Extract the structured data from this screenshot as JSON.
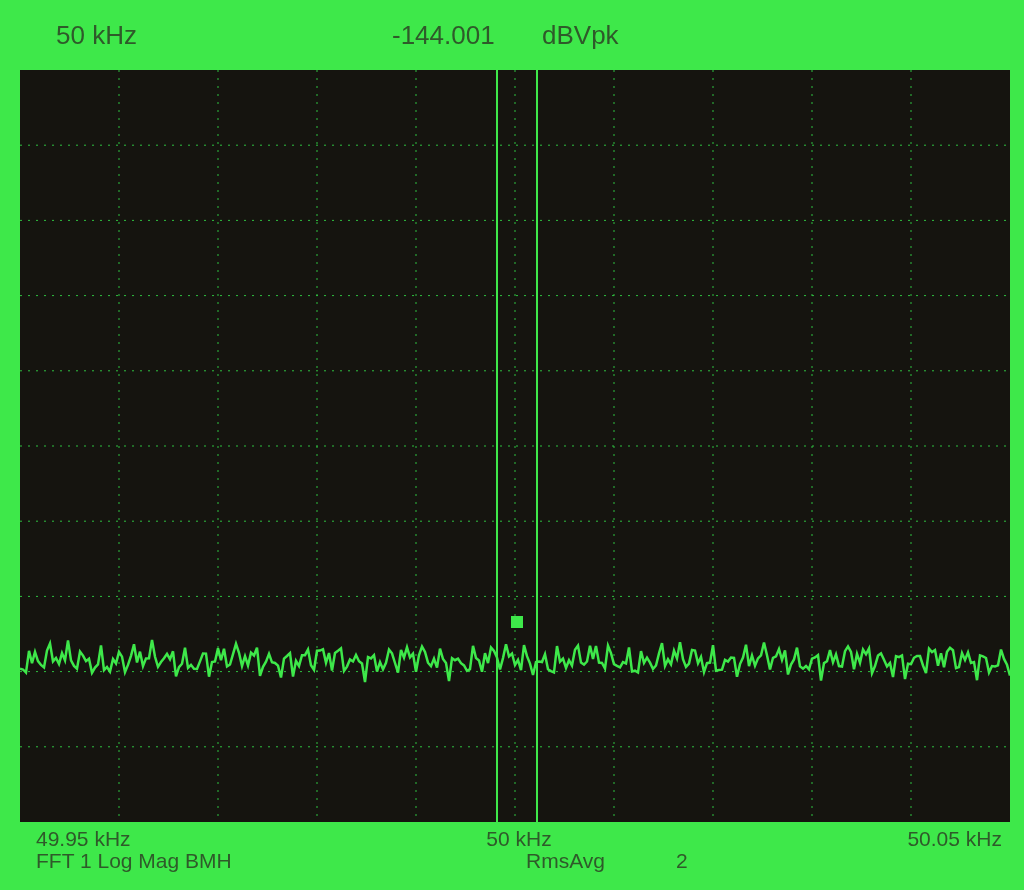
{
  "header": {
    "marker_frequency": "50 kHz",
    "marker_value": "-144.001",
    "unit": "dBVpk"
  },
  "footer": {
    "start_frequency": "49.95 kHz",
    "center_frequency": "50 kHz",
    "stop_frequency": "50.05 kHz",
    "measurement": "FFT 1 Log Mag BMH",
    "averaging": "RmsAvg",
    "average_count": "2"
  }
}
